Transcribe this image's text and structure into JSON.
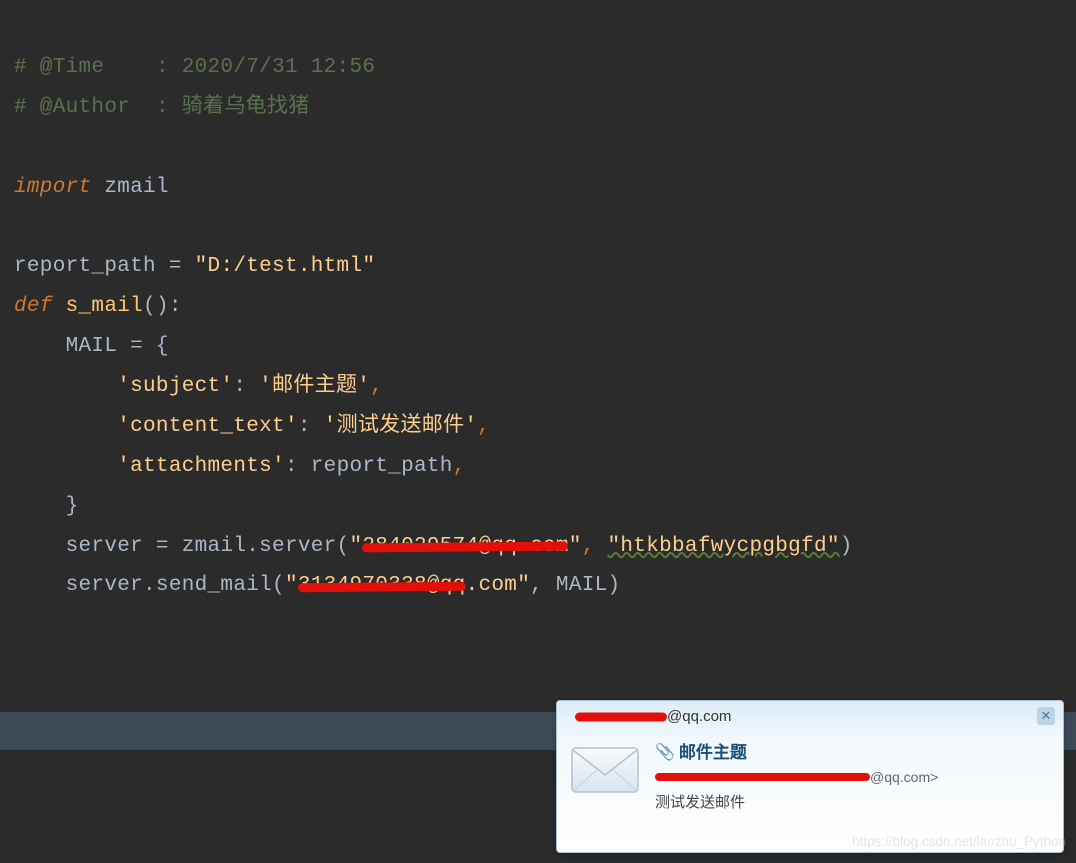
{
  "code": {
    "line1_comment": "# @Time    : 2020/7/31 12:56",
    "line2_comment": "# @Author  : 骑着乌龟找猪",
    "line3_empty": "",
    "line4_import": "import",
    "line4_module": " zmail",
    "line5_empty": "",
    "line6_var": "report_path ",
    "line6_eq": "=",
    "line6_str": " \"D:/test.html\"",
    "line7_def": "def",
    "line7_name": " s_mail",
    "line7_paren": "():",
    "line8": "    MAIL = {",
    "line9_key": "        'subject'",
    "line9_colon": ": ",
    "line9_val": "'邮件主题'",
    "line10_key": "        'content_text'",
    "line10_colon": ": ",
    "line10_val": "'测试发送邮件'",
    "line11_key": "        'attachments'",
    "line11_colon": ": ",
    "line11_val": "report_path",
    "line12": "    }",
    "line13_pre": "    server = zmail.server(",
    "line13_q1a": "\"",
    "line13_red1": "284029574@qq.com",
    "line13_q1b": "\"",
    "line13_sep": ", ",
    "line13_arg2": "\"htkbbafwycpgbgfd\"",
    "line13_end": ")",
    "line14_pre": "    server.send_mail(",
    "line14_q1a": "\"",
    "line14_red": "3134970338@qq",
    "line14_tail": ".com",
    "line14_q1b": "\"",
    "line14_sep": ", MAIL)",
    "comma": ","
  },
  "popup": {
    "header_suffix": "@qq.com",
    "attach_glyph": "📎",
    "subject": "邮件主题",
    "from_suffix": "@qq.com>",
    "content": "测试发送邮件",
    "close": "✕"
  },
  "watermark": "https://blog.csdn.net/laozhu_Python"
}
